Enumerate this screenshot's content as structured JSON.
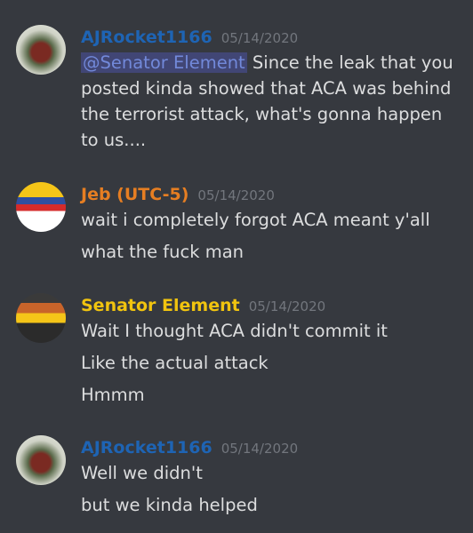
{
  "messages": [
    {
      "author": "AJRocket1166",
      "author_color": "#1e64b4",
      "timestamp": "05/14/2020",
      "avatar": "soldier-avatar",
      "mention": "@Senator Element",
      "lines": [
        "Since the leak that you posted kinda showed that ACA was behind the terrorist attack, what's gonna happen to us...."
      ]
    },
    {
      "author": "Jeb (UTC-5)",
      "author_color": "#e67e22",
      "timestamp": "05/14/2020",
      "avatar": "flag-ball-avatar",
      "lines": [
        "wait i completely forgot ACA meant y'all",
        "what the fuck man"
      ]
    },
    {
      "author": "Senator Element",
      "author_color": "#f1c40f",
      "timestamp": "05/14/2020",
      "avatar": "senator-ball-avatar",
      "lines": [
        "Wait I thought ACA didn't commit it",
        "Like the actual attack",
        "Hmmm"
      ]
    },
    {
      "author": "AJRocket1166",
      "author_color": "#1e64b4",
      "timestamp": "05/14/2020",
      "avatar": "soldier-avatar",
      "lines": [
        "Well we didn't",
        "but we kinda helped"
      ]
    }
  ]
}
